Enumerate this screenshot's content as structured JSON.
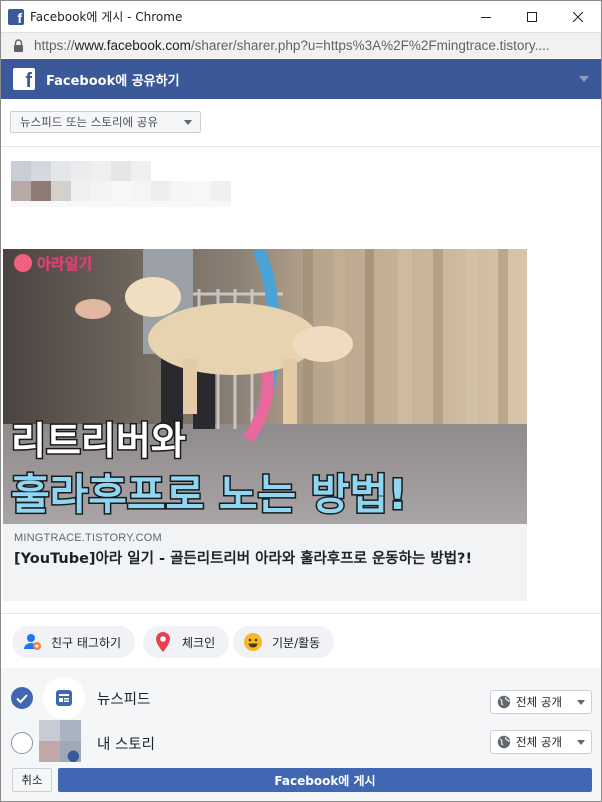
{
  "window": {
    "title": "Facebook에 게시 - Chrome",
    "fb_glyph": "f"
  },
  "address": {
    "scheme": "https://",
    "host": "www.facebook.com",
    "path": "/sharer/sharer.php?u=https%3A%2F%2Fmingtrace.tistory...."
  },
  "header": {
    "logo_glyph": "f",
    "title": "Facebook에 공유하기"
  },
  "share_target": {
    "selected": "뉴스피드 또는 스토리에 공유"
  },
  "link_preview": {
    "domain": "MINGTRACE.TISTORY.COM",
    "title": "[YouTube]아라 일기 - 골든리트리버 아라와 훌라후프로 운동하는 방법?!",
    "thumb_badge": "아라일기",
    "thumb_line1": "리트리버와",
    "thumb_line2": "훌라후프로 노는 방법!"
  },
  "actions": {
    "tag_friends": "친구 태그하기",
    "checkin": "체크인",
    "feeling": "기분/활동"
  },
  "destinations": {
    "newsfeed": {
      "label": "뉴스피드",
      "audience": "전체 공개",
      "checked": true
    },
    "story": {
      "label": "내 스토리",
      "audience": "전체 공개",
      "checked": false
    }
  },
  "footer": {
    "cancel": "취소",
    "post": "Facebook에 게시"
  },
  "colors": {
    "facebook_blue": "#3b5998",
    "button_blue": "#4267b2"
  },
  "icons": [
    "facebook-icon",
    "minimize-icon",
    "maximize-icon",
    "close-icon",
    "lock-icon",
    "chevron-down-icon",
    "tag-friends-icon",
    "location-pin-icon",
    "smiley-icon",
    "checkmark-icon",
    "newsfeed-icon",
    "globe-icon"
  ]
}
